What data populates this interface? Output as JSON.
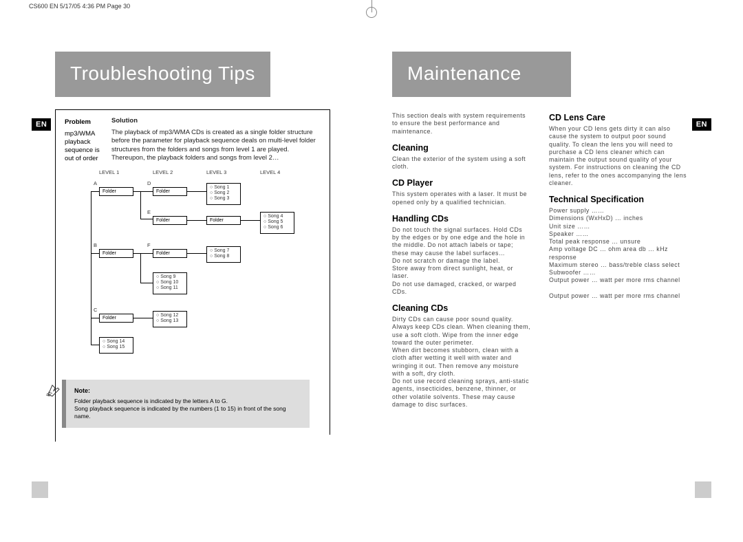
{
  "page_header": "CS600 EN  5/17/05  4:36 PM  Page 30",
  "left": {
    "banner": "Troubleshooting Tips",
    "en_tab": "EN",
    "table": {
      "problem_header": "Problem",
      "solution_header": "Solution",
      "problem": "mp3/WMA playback sequence is out of order",
      "solution": "The playback of mp3/WMA CDs is created as a single folder structure before the parameter for playback sequence deals on multi-level folder structures from the folders and songs from level 1 are played. Thereupon, the playback folders and songs from level 2…"
    },
    "diagram": {
      "levels": [
        "LEVEL 1",
        "LEVEL 2",
        "LEVEL 3",
        "LEVEL 4"
      ],
      "folder_label": "Folder",
      "folders": [
        "A",
        "B",
        "C",
        "D",
        "E",
        "F"
      ],
      "song_label": "Song",
      "song_groups": [
        [
          "Song 1",
          "Song 2",
          "Song 3"
        ],
        [
          "Song 4",
          "Song 5",
          "Song 6"
        ],
        [
          "Song 7",
          "Song 8"
        ],
        [
          "Song 9",
          "Song 10",
          "Song 11"
        ],
        [
          "Song 12",
          "Song 13"
        ],
        [
          "Song 14",
          "Song 15"
        ]
      ]
    },
    "note": {
      "title": "Note:",
      "line1": "Folder playback sequence is indicated by the letters A to G.",
      "line2": "Song playback sequence is indicated by the numbers (1 to 15) in front of the song name."
    }
  },
  "right": {
    "banner": "Maintenance",
    "en_tab": "EN",
    "intro": "This section deals with system requirements to ensure the best performance and maintenance.",
    "col1": {
      "h_cleaning": "Cleaning",
      "p_cleaning": "Clean the exterior of the system using a soft cloth.",
      "h_cdplayer": "CD Player",
      "p_cdplayer": "This system operates with a laser. It must be opened only by a qualified technician.",
      "h_handling": "Handling CDs",
      "p_handling": "Do not touch the signal surfaces. Hold CDs by the edges or by one edge and the hole in the middle. Do not attach labels or tape; these may cause the label surfaces…\nDo not scratch or damage the label.\nStore away from direct sunlight, heat, or laser.\nDo not use damaged, cracked, or warped CDs.",
      "h_cleaningcds": "Cleaning CDs",
      "p_cleaningcds": "Dirty CDs can cause poor sound quality. Always keep CDs clean. When cleaning them, use a soft cloth. Wipe from the inner edge toward the outer perimeter.\nWhen dirt becomes stubborn, clean with a cloth after wetting it well with water and wringing it out. Then remove any moisture with a soft, dry cloth.\nDo not use record cleaning sprays, anti-static agents, insecticides, benzene, thinner, or other volatile solvents. These may cause damage to disc surfaces."
    },
    "col2": {
      "h_lens": "CD Lens Care",
      "p_lens": "When your CD lens gets dirty it can also cause the system to output poor sound quality. To clean the lens you will need to purchase a CD lens cleaner which can maintain the output sound quality of your system. For instructions on cleaning the CD lens, refer to the ones accompanying the lens cleaner.",
      "h_tech": "Technical Specification",
      "p_tech": "Power supply ……\nDimensions (WxHxD) … inches\nUnit size ……\nSpeaker ……\nTotal peak response … unsure\nAmp voltage DC … ohm area db … kHz response\nMaximum stereo  … bass/treble class select\nSubwoofer ……\nOutput power … watt per more rms channel\n\nOutput power … watt per more rms channel"
    }
  }
}
